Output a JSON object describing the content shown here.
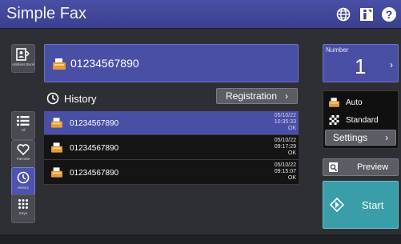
{
  "app": {
    "title": "Simple Fax"
  },
  "rail": {
    "address_book": "Address Book",
    "all": "All",
    "favorite": "Favorite",
    "history": "History",
    "keys": "Keys"
  },
  "destination": {
    "number": "01234567890"
  },
  "history": {
    "label": "History",
    "registration_label": "Registration",
    "rows": [
      {
        "number": "01234567890",
        "date": "05/10/22",
        "time": "10:35:33",
        "status": "OK"
      },
      {
        "number": "01234567890",
        "date": "05/10/22",
        "time": "09:17:29",
        "status": "OK"
      },
      {
        "number": "01234567890",
        "date": "05/10/22",
        "time": "09:15:07",
        "status": "OK"
      }
    ]
  },
  "number_card": {
    "label": "Number",
    "value": "1"
  },
  "settings": {
    "mode": "Auto",
    "quality": "Standard",
    "button_label": "Settings"
  },
  "preview": {
    "label": "Preview"
  },
  "start": {
    "label": "Start"
  },
  "colors": {
    "accent": "#4a4fa6",
    "start": "#3a9ea9",
    "background": "#2e2f34"
  },
  "icons": {
    "globe": "globe-icon",
    "info": "info-icon",
    "help": "help-icon"
  }
}
